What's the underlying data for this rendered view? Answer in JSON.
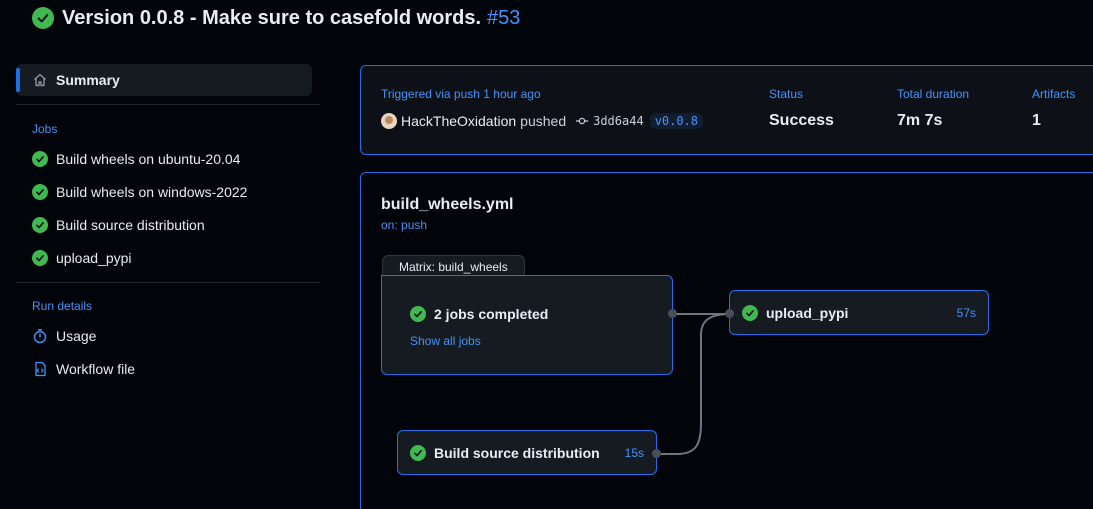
{
  "header": {
    "title": "Version 0.0.8 - Make sure to casefold words.",
    "run_number": "#53"
  },
  "sidebar": {
    "summary_label": "Summary",
    "jobs_title": "Jobs",
    "jobs": [
      {
        "label": "Build wheels on ubuntu-20.04"
      },
      {
        "label": "Build wheels on windows-2022"
      },
      {
        "label": "Build source distribution"
      },
      {
        "label": "upload_pypi"
      }
    ],
    "run_details_title": "Run details",
    "run_details": [
      {
        "label": "Usage",
        "icon": "stopwatch-icon"
      },
      {
        "label": "Workflow file",
        "icon": "file-code-icon"
      }
    ]
  },
  "summary": {
    "triggered": "Triggered via push 1 hour ago",
    "actor": "HackTheOxidation",
    "pushed": "pushed",
    "commit": "3dd6a44",
    "tag": "v0.0.8",
    "status_label": "Status",
    "status_value": "Success",
    "duration_label": "Total duration",
    "duration_value": "7m 7s",
    "artifacts_label": "Artifacts",
    "artifacts_value": "1"
  },
  "graph": {
    "workflow_file": "build_wheels.yml",
    "trigger": "on: push",
    "matrix_title": "Matrix: build_wheels",
    "matrix_summary": "2 jobs completed",
    "matrix_link": "Show all jobs",
    "upload_job": "upload_pypi",
    "upload_duration": "57s",
    "sdist_job": "Build source distribution",
    "sdist_duration": "15s"
  },
  "colors": {
    "success": "#3fb950",
    "accent": "#1f6feb",
    "link": "#4493f8",
    "background": "#010409"
  }
}
